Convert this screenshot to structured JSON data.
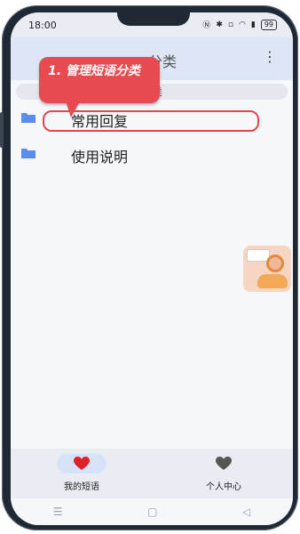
{
  "status_bar": {
    "time": "18:00",
    "icons": [
      "nfc-icon",
      "bluetooth-icon",
      "silent-icon",
      "hd-icon",
      "wifi-icon",
      "signal-icon",
      "battery-icon"
    ],
    "battery": "99"
  },
  "app_bar": {
    "title": "分类",
    "more_icon": "more-vert-icon"
  },
  "search": {
    "text": "类"
  },
  "categories": [
    {
      "label": "常用回复",
      "icon": "folder-icon"
    },
    {
      "label": "使用说明",
      "icon": "folder-icon"
    }
  ],
  "callout": {
    "text": "1. 管理短语分类"
  },
  "bottom_nav": [
    {
      "label": "我的短语",
      "icon": "heart-icon",
      "active": true,
      "color": "#e0202a"
    },
    {
      "label": "个人中心",
      "icon": "heart-icon",
      "active": false,
      "color": "#555555"
    }
  ],
  "colors": {
    "accent": "#e84a4f",
    "folder": "#5b8def",
    "app_bar_bg": "#dde6f5"
  }
}
